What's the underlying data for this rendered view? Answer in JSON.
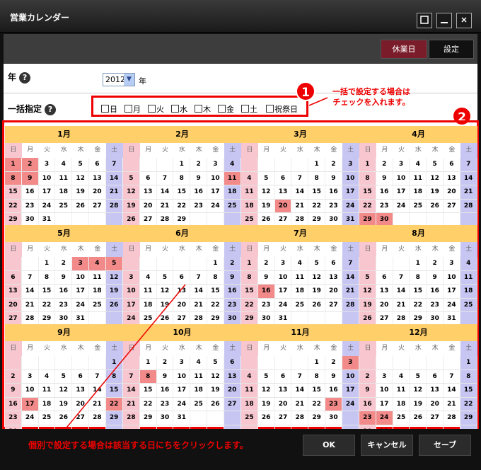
{
  "app": {
    "title": "営業カレンダー"
  },
  "window_buttons": [
    "□",
    "_",
    "×"
  ],
  "toolbar": {
    "holiday_label": "休業日",
    "settings_label": "設定"
  },
  "year_row": {
    "label": "年",
    "value": "2012",
    "unit": "年"
  },
  "bulk_row": {
    "label": "一括指定",
    "days": [
      "日",
      "月",
      "火",
      "水",
      "木",
      "金",
      "土",
      "祝祭日"
    ]
  },
  "annotations": {
    "one": "1",
    "one_text": "一括で設定する場合は\nチェックを入れます。",
    "two": "2",
    "bottom_text": "個別で設定する場合は該当する日にちをクリックします。"
  },
  "weekday_headers": [
    "日",
    "月",
    "火",
    "水",
    "木",
    "金",
    "土"
  ],
  "months": [
    {
      "name": "1月",
      "start": 0,
      "days": 31,
      "highlight": [
        1,
        2,
        8,
        9
      ]
    },
    {
      "name": "2月",
      "start": 3,
      "days": 29,
      "highlight": [
        11
      ]
    },
    {
      "name": "3月",
      "start": 4,
      "days": 31,
      "highlight": [
        20
      ]
    },
    {
      "name": "4月",
      "start": 0,
      "days": 30,
      "highlight": [
        29,
        30
      ]
    },
    {
      "name": "5月",
      "start": 2,
      "days": 31,
      "highlight": [
        3,
        4,
        5
      ]
    },
    {
      "name": "6月",
      "start": 5,
      "days": 30,
      "highlight": []
    },
    {
      "name": "7月",
      "start": 0,
      "days": 31,
      "highlight": [
        16
      ]
    },
    {
      "name": "8月",
      "start": 3,
      "days": 31,
      "highlight": []
    },
    {
      "name": "9月",
      "start": 6,
      "days": 30,
      "highlight": [
        17,
        22
      ]
    },
    {
      "name": "10月",
      "start": 1,
      "days": 31,
      "highlight": [
        8
      ]
    },
    {
      "name": "11月",
      "start": 4,
      "days": 30,
      "highlight": [
        3,
        23
      ]
    },
    {
      "name": "12月",
      "start": 6,
      "days": 31,
      "highlight": [
        23,
        24
      ]
    }
  ],
  "footer": {
    "ok": "OK",
    "cancel": "キャンセル",
    "save": "セーブ"
  },
  "colors": {
    "sun": "#f7c6cf",
    "sat": "#c7c6f3",
    "holiday": "#f28a8a",
    "month_header": "#ffcf6a",
    "accent": "#dd0000"
  }
}
